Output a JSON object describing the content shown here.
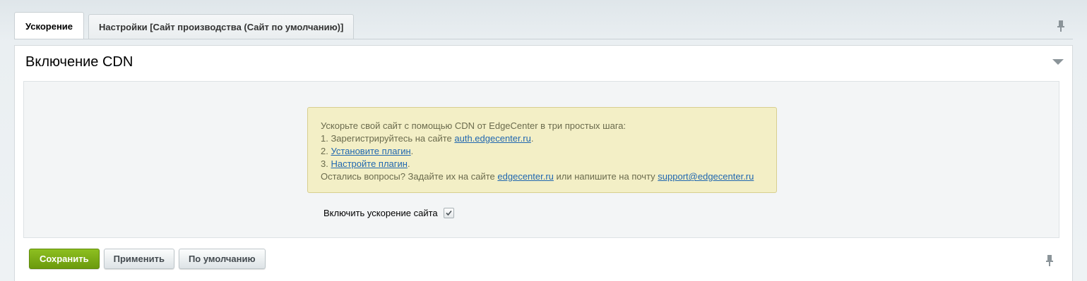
{
  "tabs": [
    {
      "label": "Ускорение",
      "active": true
    },
    {
      "label": "Настройки [Сайт производства (Сайт по умолчанию)]",
      "active": false
    }
  ],
  "panel": {
    "title": "Включение CDN"
  },
  "notice": {
    "line1": "Ускорьте свой сайт с помощью CDN от EdgeCenter в три простых шага:",
    "step1_prefix": "1. Зарегистрируйтесь на сайте ",
    "step1_link": "auth.edgecenter.ru",
    "step1_suffix": ".",
    "step2_prefix": "2. ",
    "step2_link": "Установите плагин",
    "step2_suffix": ".",
    "step3_prefix": "3. ",
    "step3_link": "Настройте плагин",
    "step3_suffix": ".",
    "questions_prefix": "Остались вопросы? Задайте их на сайте ",
    "questions_link1": "edgecenter.ru",
    "questions_middle": " или напишите на почту ",
    "questions_link2": "support@edgecenter.ru"
  },
  "option": {
    "label": "Включить ускорение сайта",
    "checked": true
  },
  "buttons": {
    "save": "Сохранить",
    "apply": "Применить",
    "default": "По умолчанию"
  },
  "colors": {
    "accent_green": "#7aab16",
    "link": "#2067b0",
    "notice_bg": "#f3efc6"
  }
}
